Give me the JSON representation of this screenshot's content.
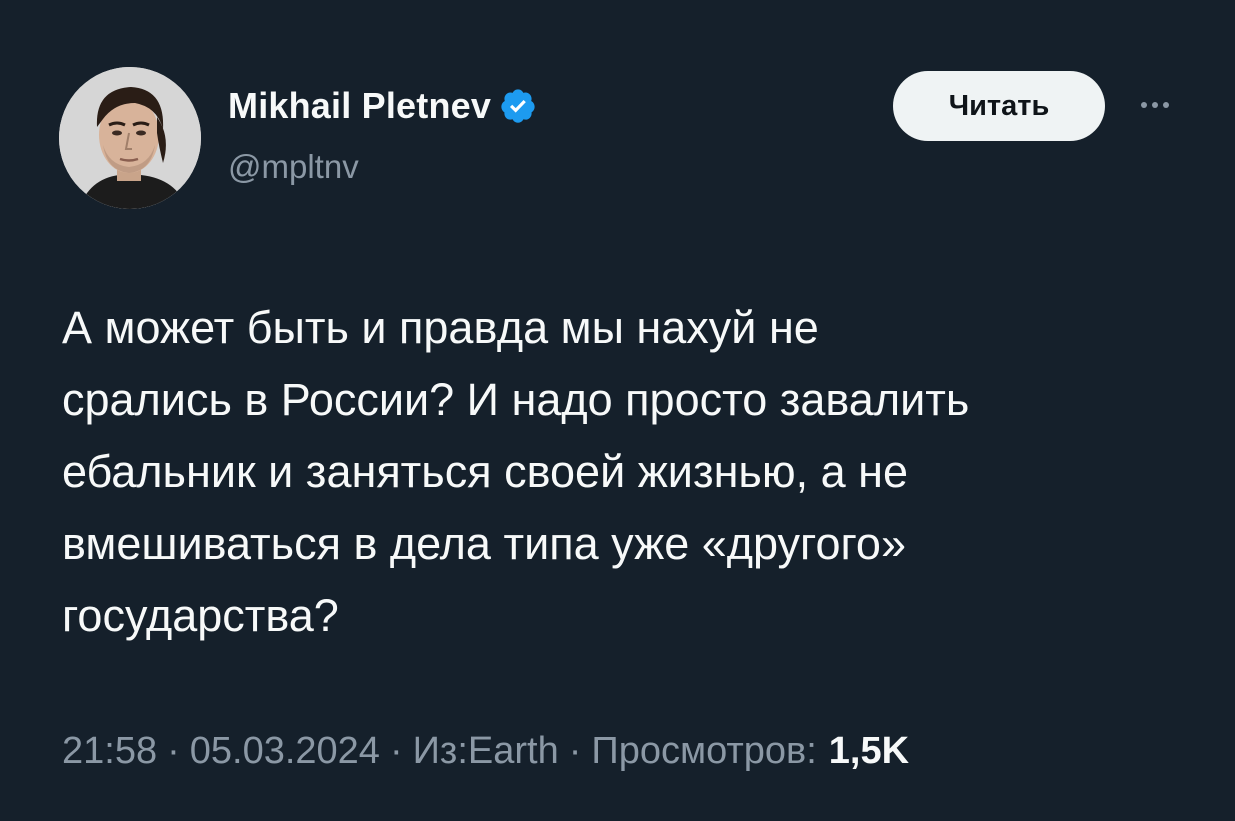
{
  "author": {
    "display_name": "Mikhail Pletnev",
    "handle": "@mpltnv",
    "verified": true,
    "avatar_icon": "profile-photo"
  },
  "actions": {
    "follow_label": "Читать",
    "more_icon": "ellipsis-icon"
  },
  "tweet": {
    "text": "А может быть и правда мы нахуй не\nсрались в России? И надо просто завалить\nебальник и заняться своей жизнью, а не\nвмешиваться в дела типа уже «другого»\nгосударства?"
  },
  "meta": {
    "time": "21:58",
    "date": "05.03.2024",
    "source": "Из:Earth",
    "views_label": "Просмотров:",
    "views_count": "1,5K"
  },
  "colors": {
    "background": "#15202b",
    "verified_badge": "#1d9bf0",
    "secondary_text": "#8b98a5"
  }
}
